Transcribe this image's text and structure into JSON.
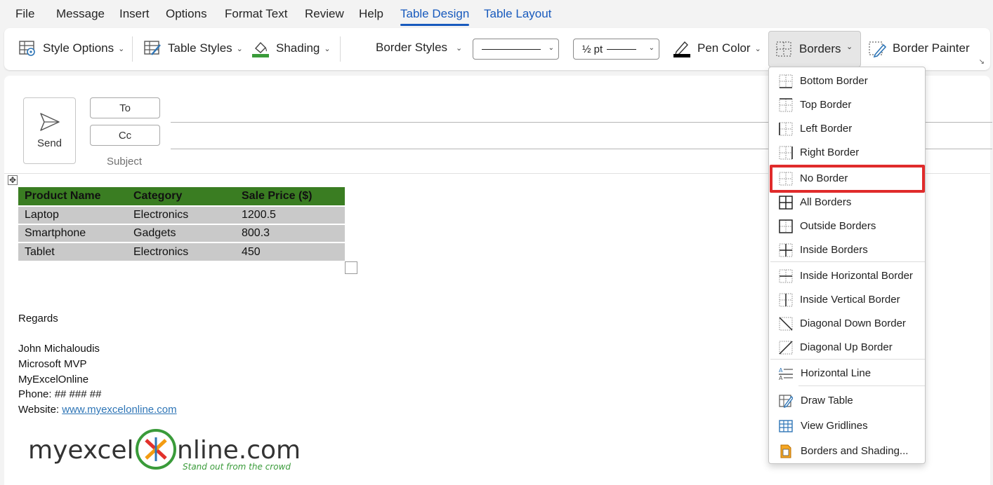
{
  "menu": {
    "tabs": [
      "File",
      "Message",
      "Insert",
      "Options",
      "Format Text",
      "Review",
      "Help",
      "Table Design",
      "Table Layout"
    ],
    "active": "Table Design"
  },
  "ribbon": {
    "style_options": "Style Options",
    "table_styles": "Table Styles",
    "shading": "Shading",
    "border_styles": "Border Styles",
    "line_weight": "½ pt",
    "pen_color": "Pen Color",
    "borders": "Borders",
    "border_painter": "Border Painter"
  },
  "compose": {
    "send": "Send",
    "to": "To",
    "cc": "Cc",
    "subject": "Subject"
  },
  "table": {
    "headers": [
      "Product Name",
      "Category",
      "Sale Price ($)"
    ],
    "rows": [
      [
        "Laptop",
        "Electronics",
        "1200.5"
      ],
      [
        "Smartphone",
        "Gadgets",
        "800.3"
      ],
      [
        "Tablet",
        "Electronics",
        "450"
      ]
    ]
  },
  "signature": {
    "regards": "Regards",
    "name": "John Michaloudis",
    "title": "Microsoft MVP",
    "company": "MyExcelOnline",
    "phone": "Phone: ## ### ##",
    "website_label": "Website: ",
    "website_link": "www.myexcelonline.com"
  },
  "logo": {
    "text_left": "myexcel",
    "text_right": "nline.com",
    "tagline": "Stand out from the crowd"
  },
  "dropdown": {
    "items": [
      {
        "label": "Bottom Border",
        "icon": "bottom-border-icon"
      },
      {
        "label": "Top Border",
        "icon": "top-border-icon"
      },
      {
        "label": "Left Border",
        "icon": "left-border-icon"
      },
      {
        "label": "Right Border",
        "icon": "right-border-icon"
      },
      {
        "label": "No Border",
        "icon": "no-border-icon"
      },
      {
        "label": "All Borders",
        "icon": "all-borders-icon"
      },
      {
        "label": "Outside Borders",
        "icon": "outside-borders-icon"
      },
      {
        "label": "Inside Borders",
        "icon": "inside-borders-icon"
      },
      {
        "label": "Inside Horizontal Border",
        "icon": "inside-horizontal-border-icon"
      },
      {
        "label": "Inside Vertical Border",
        "icon": "inside-vertical-border-icon"
      },
      {
        "label": "Diagonal Down Border",
        "icon": "diagonal-down-border-icon"
      },
      {
        "label": "Diagonal Up Border",
        "icon": "diagonal-up-border-icon"
      },
      {
        "label": "Horizontal Line",
        "icon": "horizontal-line-icon"
      },
      {
        "label": "Draw Table",
        "icon": "draw-table-icon"
      },
      {
        "label": "View Gridlines",
        "icon": "view-gridlines-icon"
      },
      {
        "label": "Borders and Shading...",
        "icon": "borders-and-shading-icon"
      }
    ],
    "highlighted": "No Border"
  },
  "colors": {
    "accent": "#185abd",
    "table_header": "#3a7d22",
    "table_row": "#c9c9c9",
    "highlight_box": "#e02b2b",
    "link": "#2e75b6"
  }
}
